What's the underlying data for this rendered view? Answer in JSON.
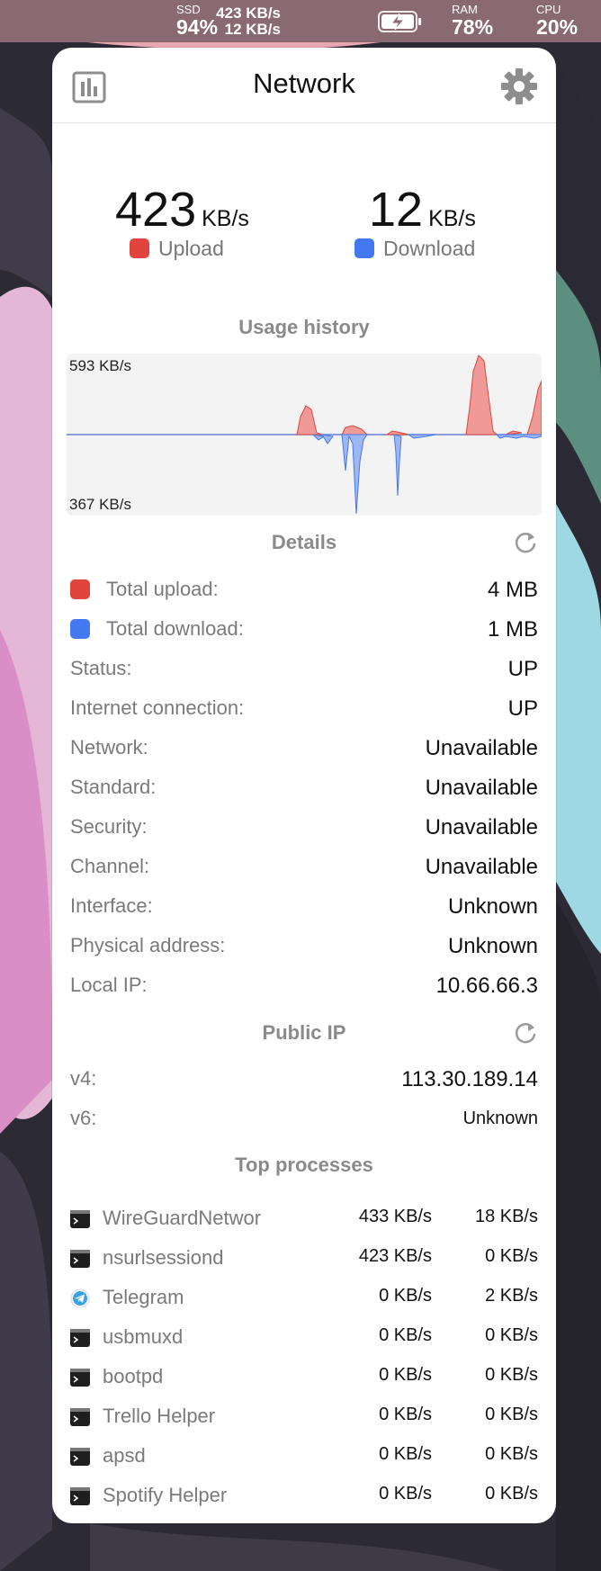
{
  "colors": {
    "upload": "#e0443c",
    "download": "#4478f0",
    "menubar": "#8a6a72"
  },
  "menubar": {
    "ssd": {
      "label": "SSD",
      "value": "94%"
    },
    "net": {
      "up": "423 KB/s",
      "down": "12 KB/s"
    },
    "battery_icon": "battery-charging-icon",
    "ram": {
      "label": "RAM",
      "value": "78%"
    },
    "cpu": {
      "label": "CPU",
      "value": "20%"
    }
  },
  "panel": {
    "title": "Network",
    "chart_icon": "chart-icon",
    "settings_icon": "gear-icon",
    "upload": {
      "value": "423",
      "unit": "KB/s",
      "label": "Upload"
    },
    "download": {
      "value": "12",
      "unit": "KB/s",
      "label": "Download"
    },
    "usage_history": {
      "title": "Usage history",
      "top_label": "593 KB/s",
      "bottom_label": "367 KB/s"
    },
    "details": {
      "title": "Details",
      "refresh_icon": "refresh-icon",
      "rows": [
        {
          "label": "Total upload:",
          "value": "4 MB"
        },
        {
          "label": "Total download:",
          "value": "1 MB"
        },
        {
          "label": "Status:",
          "value": "UP"
        },
        {
          "label": "Internet connection:",
          "value": "UP"
        },
        {
          "label": "Network:",
          "value": "Unavailable"
        },
        {
          "label": "Standard:",
          "value": "Unavailable"
        },
        {
          "label": "Security:",
          "value": "Unavailable"
        },
        {
          "label": "Channel:",
          "value": "Unavailable"
        },
        {
          "label": "Interface:",
          "value": "Unknown"
        },
        {
          "label": "Physical address:",
          "value": "Unknown"
        },
        {
          "label": "Local IP:",
          "value": "10.66.66.3"
        }
      ]
    },
    "public_ip": {
      "title": "Public IP",
      "refresh_icon": "refresh-icon",
      "v4": {
        "label": "v4:",
        "value": "113.30.189.14"
      },
      "v6": {
        "label": "v6:",
        "value": "Unknown"
      }
    },
    "top_processes": {
      "title": "Top processes",
      "items": [
        {
          "name": "WireGuardNetwor",
          "up": "433 KB/s",
          "down": "18 KB/s",
          "icon": "terminal-icon"
        },
        {
          "name": "nsurlsessiond",
          "up": "423 KB/s",
          "down": "0 KB/s",
          "icon": "terminal-icon"
        },
        {
          "name": "Telegram",
          "up": "0 KB/s",
          "down": "2 KB/s",
          "icon": "telegram-icon"
        },
        {
          "name": "usbmuxd",
          "up": "0 KB/s",
          "down": "0 KB/s",
          "icon": "terminal-icon"
        },
        {
          "name": "bootpd",
          "up": "0 KB/s",
          "down": "0 KB/s",
          "icon": "terminal-icon"
        },
        {
          "name": "Trello Helper",
          "up": "0 KB/s",
          "down": "0 KB/s",
          "icon": "terminal-icon"
        },
        {
          "name": "apsd",
          "up": "0 KB/s",
          "down": "0 KB/s",
          "icon": "terminal-icon"
        },
        {
          "name": "Spotify Helper",
          "up": "0 KB/s",
          "down": "0 KB/s",
          "icon": "terminal-icon"
        }
      ]
    }
  }
}
